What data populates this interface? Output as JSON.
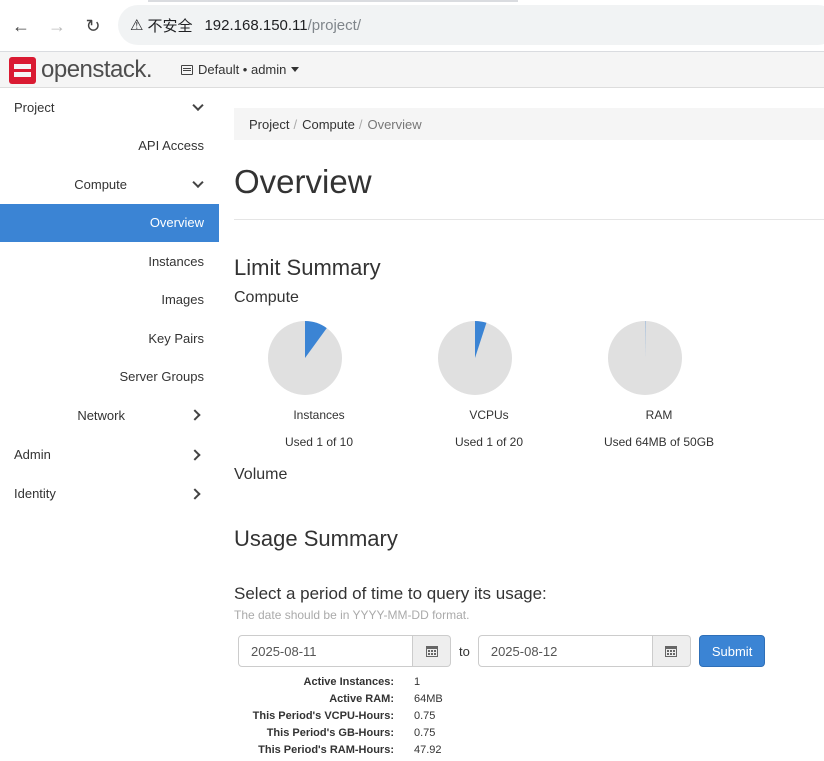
{
  "browser": {
    "security_label": "不安全",
    "url_host": "192.168.150.11",
    "url_path": "/project/"
  },
  "header": {
    "logo_text": "openstack.",
    "project_picker": "Default • admin"
  },
  "sidebar": {
    "items": [
      {
        "label": "Project"
      },
      {
        "label": "API Access"
      },
      {
        "label": "Compute"
      },
      {
        "label": "Overview"
      },
      {
        "label": "Instances"
      },
      {
        "label": "Images"
      },
      {
        "label": "Key Pairs"
      },
      {
        "label": "Server Groups"
      },
      {
        "label": "Network"
      },
      {
        "label": "Admin"
      },
      {
        "label": "Identity"
      }
    ]
  },
  "breadcrumb": {
    "items": [
      "Project",
      "Compute",
      "Overview"
    ],
    "separator": "/"
  },
  "page": {
    "title": "Overview",
    "limit_summary": "Limit Summary",
    "compute_heading": "Compute",
    "volume_heading": "Volume",
    "usage_summary": "Usage Summary"
  },
  "limits": [
    {
      "label": "Instances",
      "used_text": "Used 1 of 10",
      "used": 1,
      "total": 10
    },
    {
      "label": "VCPUs",
      "used_text": "Used 1 of 20",
      "used": 1,
      "total": 20
    },
    {
      "label": "RAM",
      "used_text": "Used 64MB of 50GB",
      "used": 64,
      "total": 51200
    }
  ],
  "colors": {
    "pie_used": "#3b84d4",
    "pie_free": "#e0e0e0",
    "accent": "#3b84d4"
  },
  "query": {
    "title": "Select a period of time to query its usage:",
    "help": "The date should be in YYYY-MM-DD format.",
    "start_date": "2025-08-11",
    "to_label": "to",
    "end_date": "2025-08-12",
    "submit_label": "Submit"
  },
  "stats": [
    {
      "key": "Active Instances:",
      "value": "1"
    },
    {
      "key": "Active RAM:",
      "value": "64MB"
    },
    {
      "key": "This Period's VCPU-Hours:",
      "value": "0.75"
    },
    {
      "key": "This Period's GB-Hours:",
      "value": "0.75"
    },
    {
      "key": "This Period's RAM-Hours:",
      "value": "47.92"
    }
  ]
}
